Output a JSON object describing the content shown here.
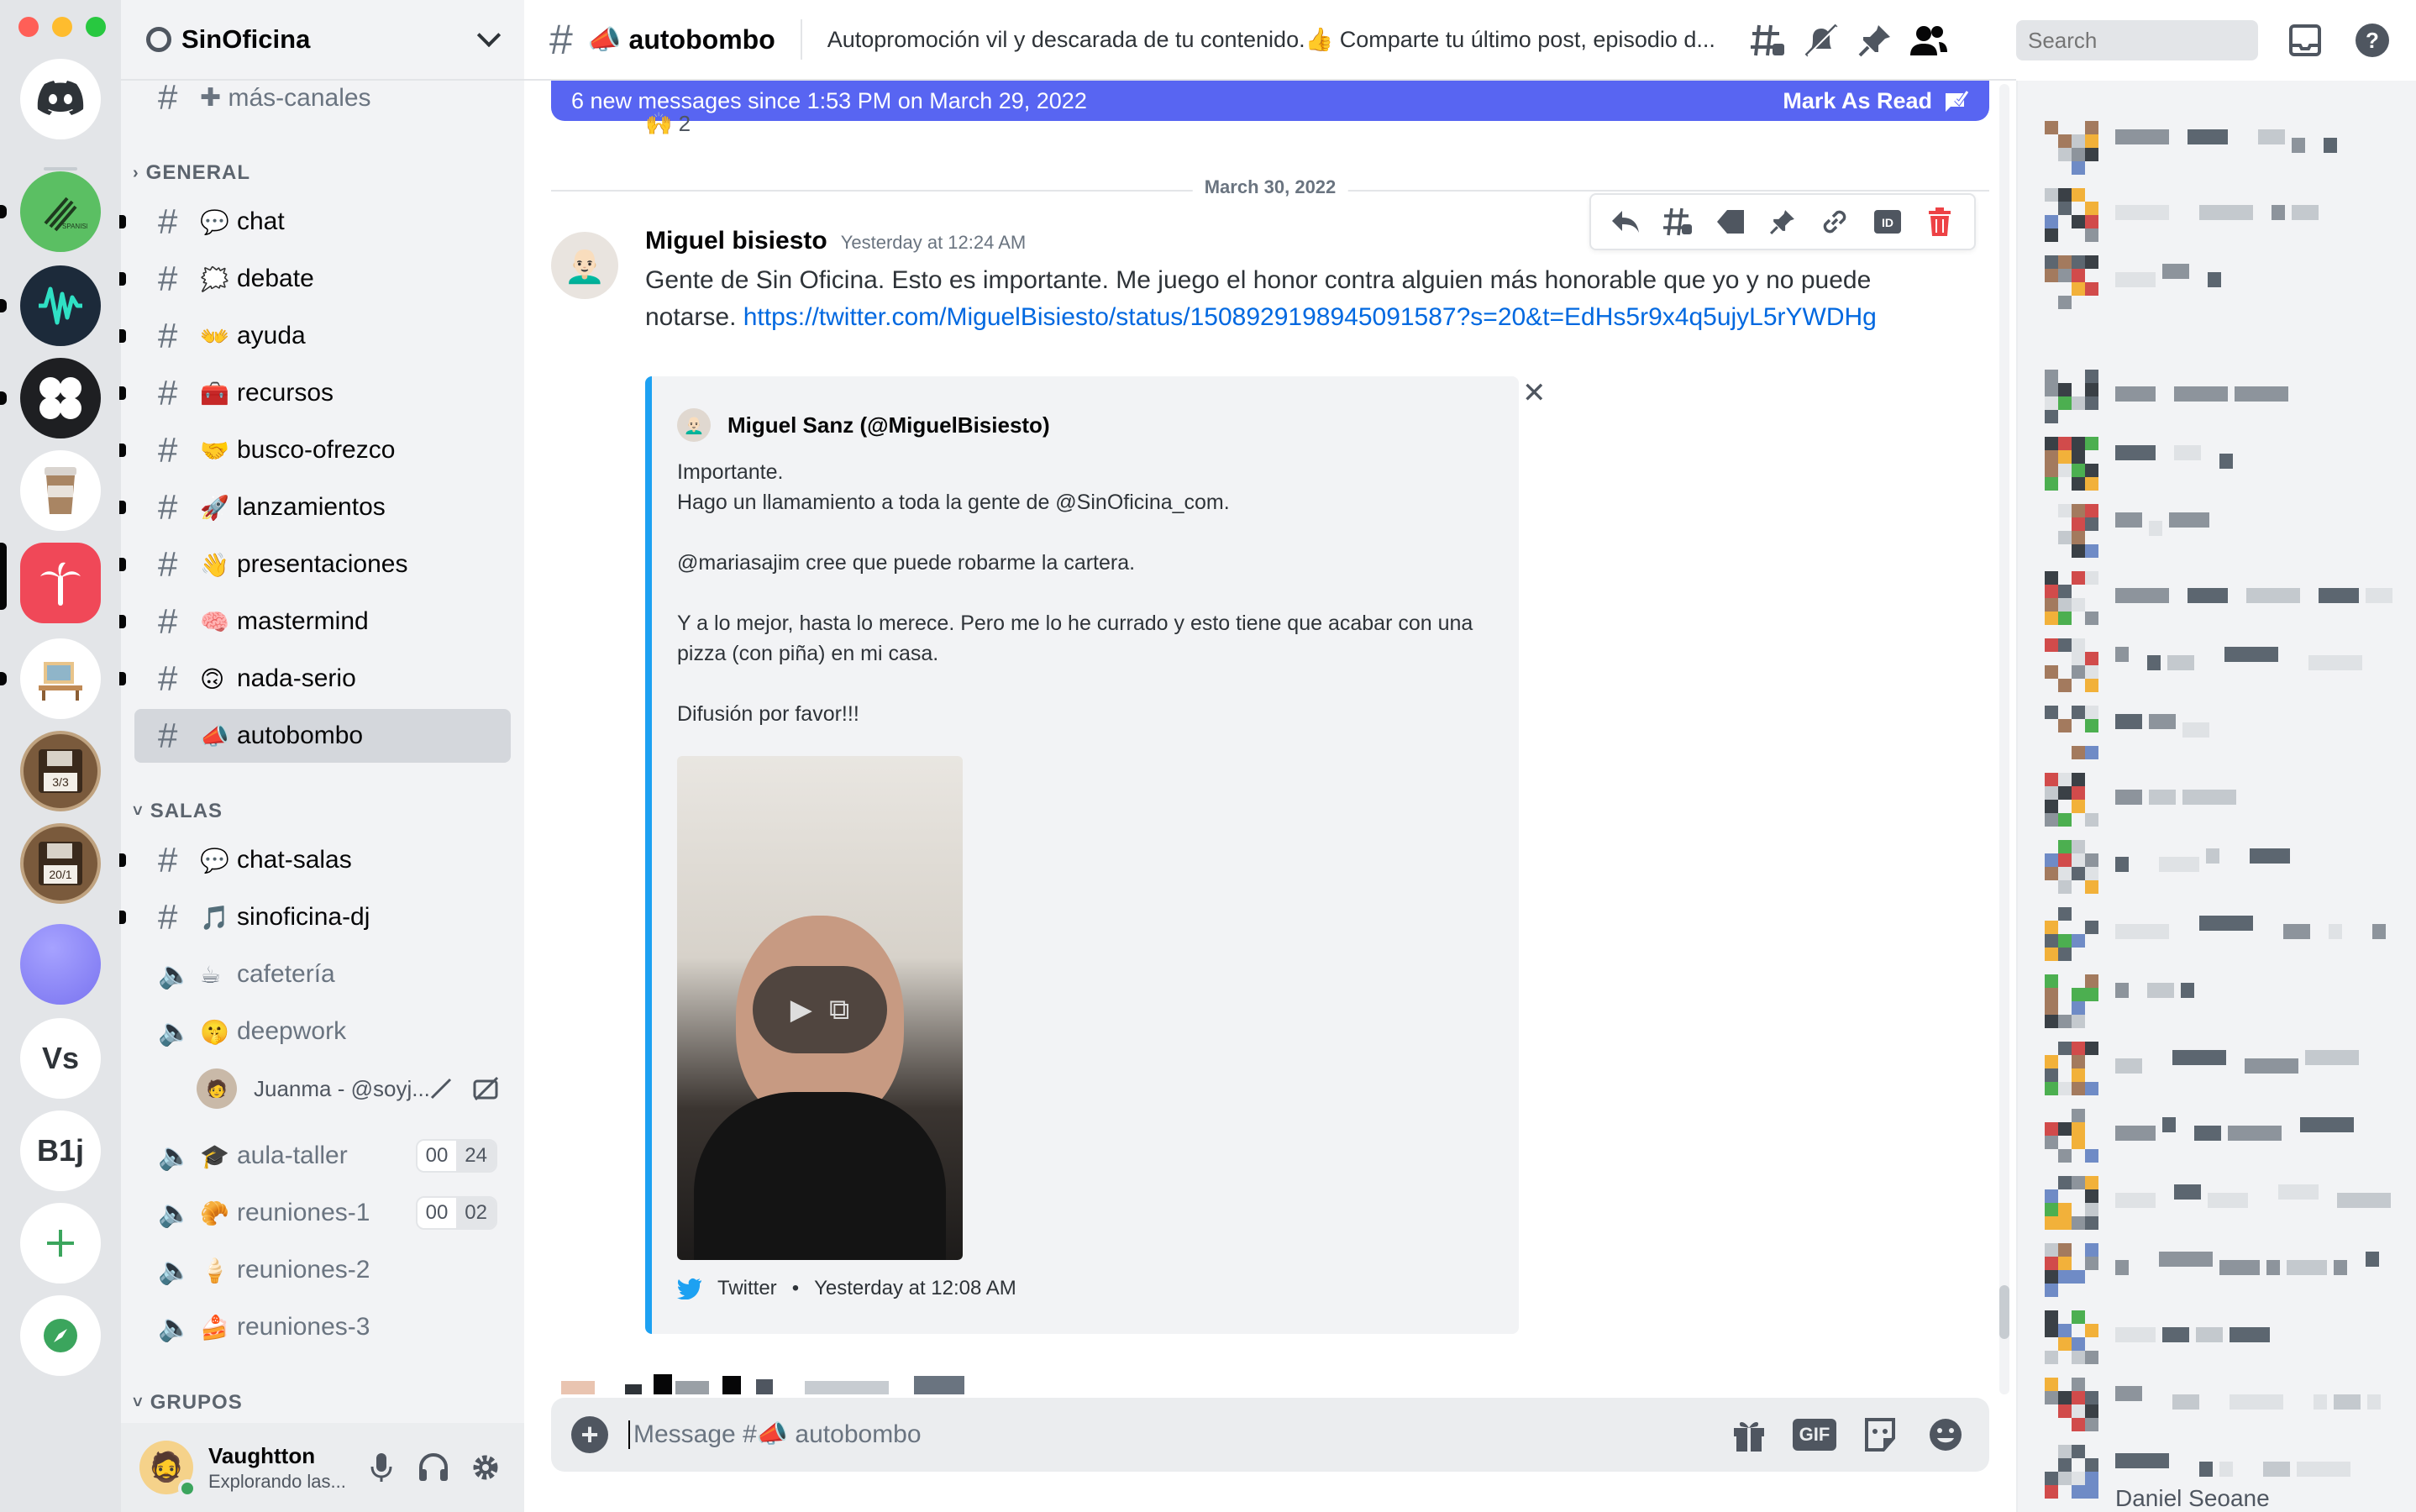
{
  "window": {
    "title": "SinOficina"
  },
  "servers": [
    {
      "name": "Discord Home",
      "kind": "home",
      "color": "#ffffff"
    },
    {
      "name": "Spanish Startups",
      "kind": "image",
      "color": "#5bbf63"
    },
    {
      "name": "Waveform",
      "kind": "image",
      "color": "#1c2a3a"
    },
    {
      "name": "Clover",
      "kind": "image",
      "color": "#1e1f22"
    },
    {
      "name": "Coffee",
      "kind": "image",
      "color": "#ffffff"
    },
    {
      "name": "SinOficina",
      "kind": "image",
      "color": "#f04858"
    },
    {
      "name": "Desk",
      "kind": "image",
      "color": "#ffffff"
    },
    {
      "name": "3/3",
      "kind": "badge",
      "color": "#7a5a3c"
    },
    {
      "name": "20/1",
      "kind": "badge",
      "color": "#7a5a3c"
    },
    {
      "name": "Purple",
      "kind": "image",
      "color": "#8a86f7"
    },
    {
      "name": "Vs",
      "kind": "text",
      "color": "#ffffff"
    },
    {
      "name": "B1j",
      "kind": "text",
      "color": "#ffffff"
    }
  ],
  "server_badges": {
    "b1": "3/3",
    "b2": "20/1",
    "vs": "Vs",
    "b1j": "B1j"
  },
  "guild": {
    "name": "SinOficina"
  },
  "sidebar": {
    "top_channel": "✚ más-canales",
    "categories": {
      "general": "GENERAL",
      "salas": "SALAS",
      "grupos": "GRUPOS"
    },
    "general": [
      {
        "emoji": "💬",
        "label": "chat"
      },
      {
        "emoji": "🗯️",
        "label": "debate"
      },
      {
        "emoji": "👐",
        "label": "ayuda"
      },
      {
        "emoji": "🧰",
        "label": "recursos"
      },
      {
        "emoji": "🤝",
        "label": "busco-ofrezco"
      },
      {
        "emoji": "🚀",
        "label": "lanzamientos"
      },
      {
        "emoji": "👋",
        "label": "presentaciones"
      },
      {
        "emoji": "🧠",
        "label": "mastermind"
      },
      {
        "emoji": "🙃",
        "label": "nada-serio"
      },
      {
        "emoji": "📣",
        "label": "autobombo"
      }
    ],
    "salas_text": [
      {
        "emoji": "💬",
        "label": "chat-salas"
      },
      {
        "emoji": "🎵",
        "label": "sinoficina-dj"
      }
    ],
    "salas_voice": [
      {
        "emoji": "☕",
        "label": "cafetería"
      },
      {
        "emoji": "🤫",
        "label": "deepwork"
      },
      {
        "emoji": "🎓",
        "label": "aula-taller",
        "count_a": "00",
        "count_b": "24"
      },
      {
        "emoji": "🥐",
        "label": "reuniones-1",
        "count_a": "00",
        "count_b": "02"
      },
      {
        "emoji": "🍦",
        "label": "reuniones-2"
      },
      {
        "emoji": "🍰",
        "label": "reuniones-3"
      }
    ],
    "voice_user": "Juanma - @soyj..."
  },
  "user": {
    "name": "Vaughtton",
    "status": "Explorando las..."
  },
  "channel": {
    "name": "autobombo",
    "emoji": "📣",
    "topic": "Autopromoción vil y descarada de tu contenido.👍 Comparte tu último post, episodio d..."
  },
  "search": {
    "placeholder": "Search"
  },
  "banner": {
    "text": "6 new messages since 1:53 PM on March 29, 2022",
    "action": "Mark As Read"
  },
  "reaction": {
    "emoji": "🙌",
    "count": "2"
  },
  "date_divider": "March 30, 2022",
  "message": {
    "author": "Miguel bisiesto",
    "time": "Yesterday at 12:24 AM",
    "text": "Gente de Sin Oficina. Esto es importante. Me juego el honor contra alguien más honorable que yo y no puede notarse. ",
    "link": "https://twitter.com/MiguelBisiesto/status/1508929198945091587?s=20&t=EdHs5r9x4q5ujyL5rYWDHg"
  },
  "embed": {
    "author": "Miguel Sanz (@MiguelBisiesto)",
    "lines": [
      "Importante.",
      "Hago un llamamiento a toda la gente de @SinOficina_com.",
      "",
      "@mariasajim cree que puede robarme la cartera.",
      "",
      "Y a lo mejor, hasta lo merece. Pero me lo he currado y esto tiene que acabar con una pizza (con piña) en mi casa.",
      "",
      "Difusión por favor!!!"
    ],
    "source": "Twitter",
    "bullet": "•",
    "time": "Yesterday at 12:08 AM",
    "accent": "#1da1f2"
  },
  "composer": {
    "placeholder": "Message #📣 autobombo",
    "gif": "GIF"
  },
  "members": {
    "last_visible": "Daniel Seoane"
  },
  "colors": {
    "brand": "#5865f2",
    "online": "#3ba55d",
    "link": "#0068e0",
    "danger": "#ed4245"
  }
}
